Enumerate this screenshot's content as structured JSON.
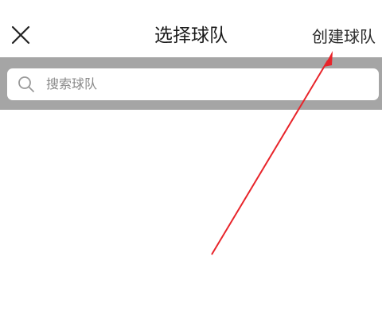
{
  "nav": {
    "close_icon": "close-icon",
    "title": "选择球队",
    "create_label": "创建球队"
  },
  "search": {
    "placeholder": "搜索球队",
    "icon": "search-icon"
  },
  "annotation": {
    "arrow_color": "#e8242a"
  },
  "colors": {
    "search_band": "#a5a5a5",
    "background": "#ffffff"
  }
}
